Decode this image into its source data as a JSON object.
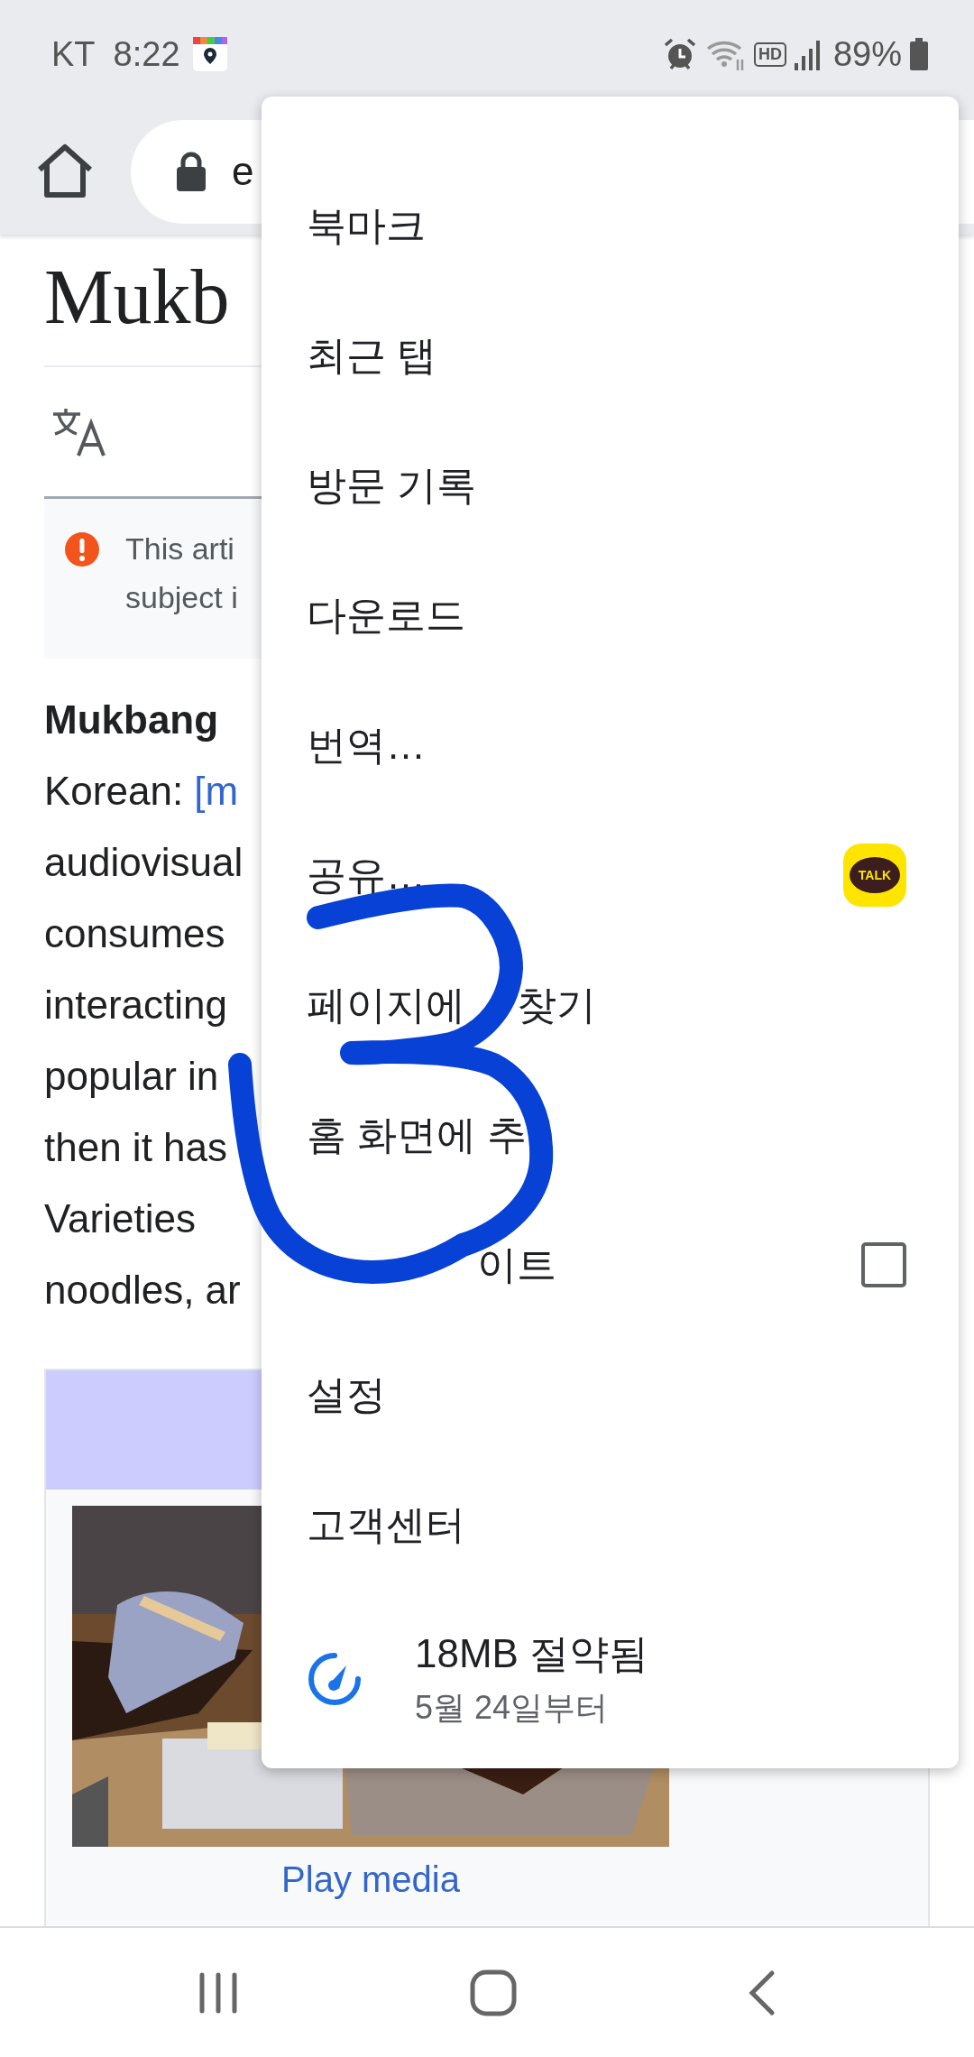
{
  "status_bar": {
    "carrier": "KT",
    "time": "8:22",
    "hd_badge": "HD",
    "battery": "89%"
  },
  "toolbar": {
    "url": "e"
  },
  "article": {
    "title": "Mukb",
    "notice": [
      "This arti",
      "subject i"
    ],
    "lines": [
      {
        "text": "**Mukbang**"
      },
      {
        "text": "Korean: ",
        "link": "[m"
      },
      {
        "text": "audiovisual"
      },
      {
        "text": "consumes"
      },
      {
        "text": "interacting"
      },
      {
        "text": "popular in"
      },
      {
        "text": "then it has"
      },
      {
        "text": "Varieties"
      },
      {
        "text": "noodles, ar"
      }
    ],
    "media_link": "Play media"
  },
  "menu": {
    "items": [
      {
        "label": "북마크",
        "kind": "plain"
      },
      {
        "label": "최근 탭",
        "kind": "plain"
      },
      {
        "label": "방문 기록",
        "kind": "plain"
      },
      {
        "label": "다운로드",
        "kind": "plain"
      },
      {
        "label": "번역…",
        "kind": "plain"
      },
      {
        "label": "공유…",
        "kind": "share",
        "app_badge": "TALK"
      },
      {
        "label_parts": [
          {
            "text": "페이지에",
            "covered_before": false
          },
          {
            "text": "찾기",
            "covered_before": true
          }
        ],
        "kind": "plain"
      },
      {
        "label": "홈 화면에 추",
        "kind": "plain"
      },
      {
        "label_parts": [
          {
            "text": "이트",
            "covered_before": true
          }
        ],
        "kind": "checkbox",
        "checked": false
      },
      {
        "label": "설정",
        "kind": "plain"
      },
      {
        "label": "고객센터",
        "kind": "plain"
      }
    ],
    "data_saver": {
      "title": "18MB 절약됨",
      "subtitle": "5월 24일부터"
    }
  }
}
